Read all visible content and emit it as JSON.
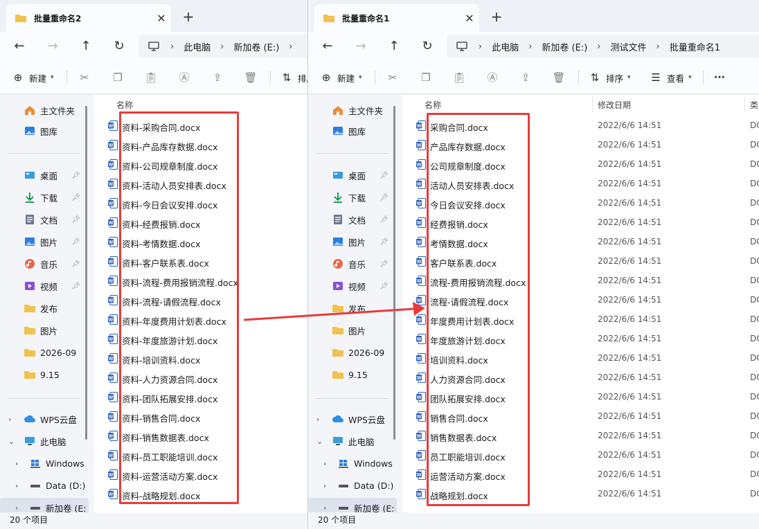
{
  "left": {
    "tab_title": "批量重命名2",
    "breadcrumbs": [
      "此电脑",
      "新加卷 (E:)"
    ],
    "toolbar": {
      "new_label": "新建",
      "sort_label": "排序"
    },
    "nav": {
      "home": "主文件夹",
      "gallery": "图库",
      "desktop": "桌面",
      "downloads": "下载",
      "documents": "文档",
      "pictures": "图片",
      "music": "音乐",
      "videos": "视频",
      "publish": "发布",
      "pictures2": "图片",
      "folder_2026": "2026-09",
      "folder_915": "9.15",
      "wps": "WPS云盘",
      "this_pc": "此电脑",
      "windows": "Windows",
      "data_d": "Data (D:)",
      "new_vol": "新加卷 (E:"
    },
    "column_name": "名称",
    "files": [
      "资料-采购合同.docx",
      "资料-产品库存数据.docx",
      "资料-公司规章制度.docx",
      "资料-活动人员安排表.docx",
      "资料-今日会议安排.docx",
      "资料-经费报销.docx",
      "资料-考情数据.docx",
      "资料-客户联系表.docx",
      "资料-流程-费用报销流程.docx",
      "资料-流程-请假流程.docx",
      "资料-年度费用计划表.docx",
      "资料-年度旅游计划.docx",
      "资料-培训资料.docx",
      "资料-人力资源合同.docx",
      "资料-团队拓展安排.docx",
      "资料-销售合同.docx",
      "资料-销售数据表.docx",
      "资料-员工职能培训.docx",
      "资料-运营活动方案.docx",
      "资料-战略规划.docx"
    ],
    "status": "20 个项目"
  },
  "right": {
    "tab_title": "批量重命名1",
    "breadcrumbs": [
      "此电脑",
      "新加卷 (E:)",
      "测试文件",
      "批量重命名1"
    ],
    "toolbar": {
      "new_label": "新建",
      "sort_label": "排序",
      "view_label": "查看",
      "more_label": "···"
    },
    "nav": {
      "home": "主文件夹",
      "gallery": "图库",
      "desktop": "桌面",
      "downloads": "下载",
      "documents": "文档",
      "pictures": "图片",
      "music": "音乐",
      "videos": "视频",
      "publish": "发布",
      "pictures2": "图片",
      "folder_2026": "2026-09",
      "folder_915": "9.15",
      "wps": "WPS云盘",
      "this_pc": "此电脑",
      "windows": "Windows",
      "data_d": "Data (D:)",
      "new_vol": "新加卷 (E:"
    },
    "column_name": "名称",
    "column_date": "修改日期",
    "column_type": "类",
    "files": [
      "采购合同.docx",
      "产品库存数据.docx",
      "公司规章制度.docx",
      "活动人员安排表.docx",
      "今日会议安排.docx",
      "经费报销.docx",
      "考情数据.docx",
      "客户联系表.docx",
      "流程-费用报销流程.docx",
      "流程-请假流程.docx",
      "年度费用计划表.docx",
      "年度旅游计划.docx",
      "培训资料.docx",
      "人力资源合同.docx",
      "团队拓展安排.docx",
      "销售合同.docx",
      "销售数据表.docx",
      "员工职能培训.docx",
      "运营活动方案.docx",
      "战略规划.docx"
    ],
    "file_date": "2022/6/6 14:51",
    "file_type": "DO",
    "status": "20 个项目"
  },
  "colors": {
    "accent_red": "#e83a3a",
    "folder_yellow": "#f2c14e",
    "word_blue": "#2b5fb4"
  }
}
